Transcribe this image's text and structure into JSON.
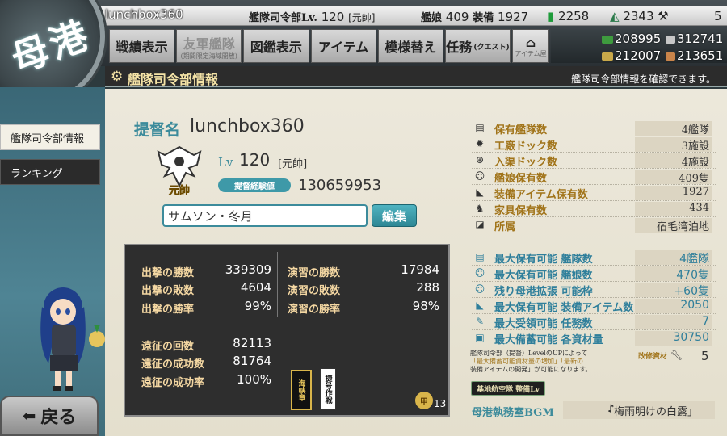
{
  "header": {
    "emblem_text": "母港",
    "username": "lunchbox360",
    "hq_level_label": "艦隊司令部Lv.",
    "hq_level": "120",
    "rank": "[元帥]",
    "ships_label": "艦娘",
    "ships": "409",
    "equip_label": "装備",
    "equip": "1927",
    "buckets": "2258",
    "dev_materials": "2343",
    "improve_materials": "5"
  },
  "nav": {
    "items": [
      {
        "label": "戦績表示",
        "sub": ""
      },
      {
        "label": "友軍艦隊",
        "sub": "(期間限定海域開放)"
      },
      {
        "label": "図鑑表示",
        "sub": ""
      },
      {
        "label": "アイテム",
        "sub": ""
      },
      {
        "label": "模様替え",
        "sub": ""
      },
      {
        "label": "任務",
        "sub": "(クエスト)"
      }
    ],
    "shop_label": "アイテム屋"
  },
  "resources": {
    "fuel": "208995",
    "ammo": "312741",
    "steel": "212007",
    "bauxite": "213651"
  },
  "page": {
    "title": "艦隊司令部情報",
    "hint": "艦隊司令部情報を確認できます。"
  },
  "sidebar": {
    "items": [
      "艦隊司令部情報",
      "ランキング"
    ]
  },
  "back_label": "戻る",
  "admiral": {
    "label": "提督名",
    "name": "lunchbox360",
    "rank_badge": "元帥",
    "lv_label": "Lv",
    "lv": "120",
    "rank": "[元帥]",
    "exp_label": "提督経験値",
    "exp": "130659953",
    "comment": "サムソン・冬月",
    "edit_label": "編集"
  },
  "record": {
    "sortie_wins_label": "出撃の勝数",
    "sortie_wins": "339309",
    "sortie_losses_label": "出撃の敗数",
    "sortie_losses": "4604",
    "sortie_rate_label": "出撃の勝率",
    "sortie_rate": "99%",
    "pvp_wins_label": "演習の勝数",
    "pvp_wins": "17984",
    "pvp_losses_label": "演習の敗数",
    "pvp_losses": "288",
    "pvp_rate_label": "演習の勝率",
    "pvp_rate": "98%",
    "exp_count_label": "遠征の回数",
    "exp_count": "82113",
    "exp_success_label": "遠征の成功数",
    "exp_success": "81764",
    "exp_rate_label": "遠征の成功率",
    "exp_rate": "100%",
    "medal_1": "海峡章",
    "medal_2": "捷号作戦",
    "medal_3": "甲",
    "medal_3_count": "13"
  },
  "stats": [
    {
      "label": "保有艦隊数",
      "value": "4艦隊",
      "icon": "fleet-icon"
    },
    {
      "label": "工廠ドック数",
      "value": "3施設",
      "icon": "factory-icon"
    },
    {
      "label": "入渠ドック数",
      "value": "4施設",
      "icon": "repair-dock-icon"
    },
    {
      "label": "艦娘保有数",
      "value": "409隻",
      "icon": "shipgirl-icon"
    },
    {
      "label": "装備アイテム保有数",
      "value": "1927",
      "icon": "equipment-icon"
    },
    {
      "label": "家具保有数",
      "value": "434",
      "icon": "furniture-icon"
    },
    {
      "label": "所属",
      "value": "宿毛湾泊地",
      "icon": "base-icon"
    }
  ],
  "limits": [
    {
      "label": "最大保有可能 艦隊数",
      "value": "4艦隊",
      "icon": "fleet-icon"
    },
    {
      "label": "最大保有可能 艦娘数",
      "value": "470隻",
      "icon": "shipgirl-icon"
    },
    {
      "label": "残り母港拡張 可能枠",
      "value": "+60隻",
      "icon": "port-expand-icon"
    },
    {
      "label": "最大保有可能 装備アイテム数",
      "value": "2050",
      "icon": "equipment-icon"
    },
    {
      "label": "最大受領可能 任務数",
      "value": "7",
      "icon": "quest-icon"
    },
    {
      "label": "最大備蓄可能 各資材量",
      "value": "30750",
      "icon": "resource-icon"
    }
  ],
  "note": {
    "line1": "艦隊司令部（提督）LevelのUPによって",
    "line2": "「最大備蓄可能資材量の増加」「最新の",
    "line3": "装備アイテムの開発」が可能になります。"
  },
  "upgrade": {
    "label": "改修資材",
    "value": "5"
  },
  "airbase_label": "基地航空隊 整備Lv",
  "bgm": {
    "label": "母港執務室BGM",
    "value": "「梅雨明けの白露」"
  }
}
